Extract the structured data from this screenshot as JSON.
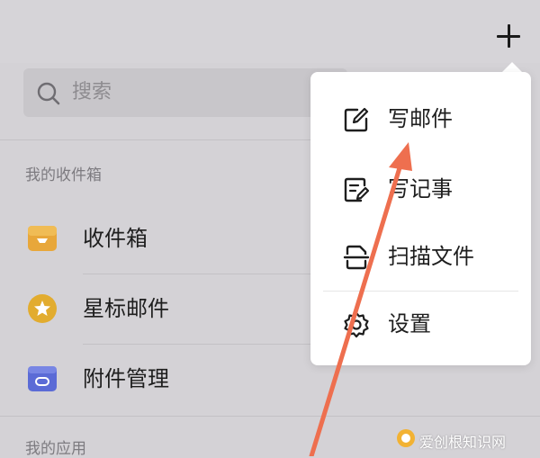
{
  "header": {
    "add_icon": "plus-icon"
  },
  "search": {
    "placeholder": "搜索",
    "icon": "search-icon"
  },
  "mailbox_section": {
    "title": "我的收件箱",
    "items": [
      {
        "label": "收件箱",
        "icon": "inbox-tray-icon",
        "color": "#e8a73a"
      },
      {
        "label": "星标邮件",
        "icon": "star-badge-icon",
        "color": "#e2ac2f"
      },
      {
        "label": "附件管理",
        "icon": "attachment-box-icon",
        "color": "#5b6bd6"
      }
    ]
  },
  "apps_section": {
    "title": "我的应用"
  },
  "popup_menu": {
    "items": [
      {
        "label": "写邮件",
        "icon": "compose-edit-icon"
      },
      {
        "label": "写记事",
        "icon": "note-edit-icon"
      },
      {
        "label": "扫描文件",
        "icon": "scan-document-icon"
      },
      {
        "label": "设置",
        "icon": "gear-icon"
      }
    ]
  },
  "annotation": {
    "arrow_color": "#ee6f4f"
  },
  "watermark": {
    "text": "爱创根知识网"
  }
}
